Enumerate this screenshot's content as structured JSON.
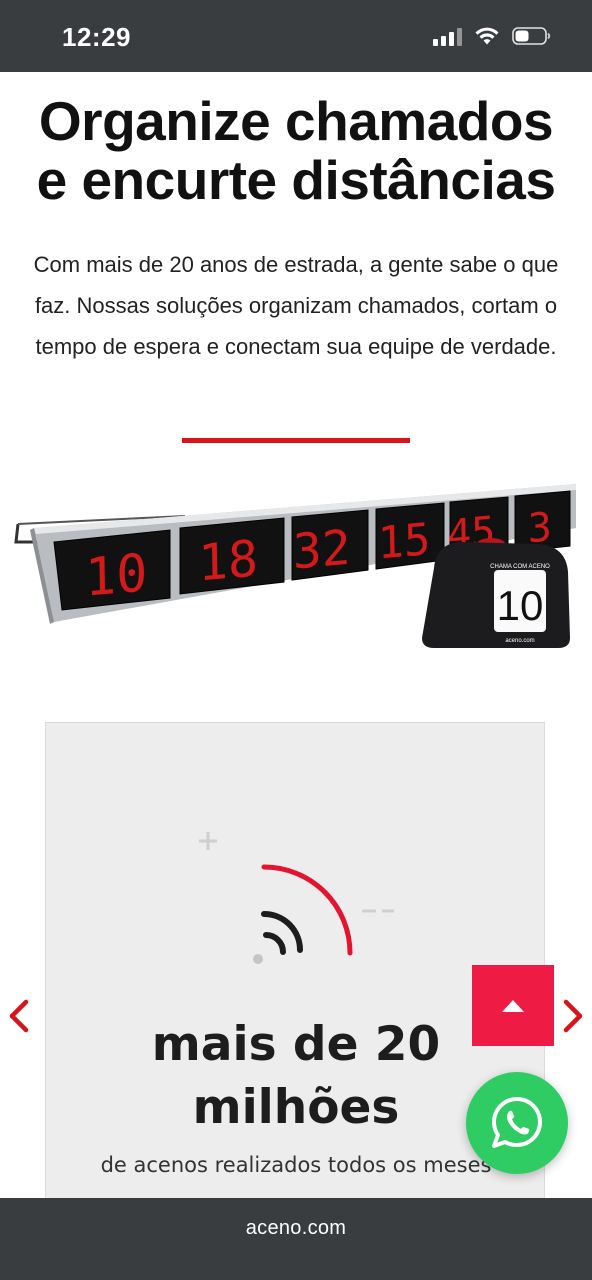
{
  "status_bar": {
    "time": "12:29",
    "icons": [
      "signal-icon",
      "wifi-icon",
      "battery-icon"
    ]
  },
  "hero": {
    "title_line1": "Organize chamados",
    "title_line2": "e encurte distâncias",
    "description": "Com mais de 20 anos de estrada, a gente sabe o que faz. Nossas soluções organizam chamados, cortam o tempo de espera e conectam sua equipe de verdade.",
    "accent_color": "#d9141b"
  },
  "product_image": {
    "display_numbers": [
      "10",
      "18",
      "32",
      "15",
      "45",
      "3"
    ],
    "device_label": "CHAMA COM ACENO",
    "device_number": "10",
    "device_brand": "aceno.com"
  },
  "stats_card": {
    "title_line1": "mais de 20",
    "title_line2": "milhões",
    "subtitle": "de acenos realizados todos os meses",
    "icon": "wave-signal-icon"
  },
  "controls": {
    "prev_icon": "chevron-left-icon",
    "next_icon": "chevron-right-icon",
    "back_to_top_icon": "caret-up-icon",
    "back_to_top_color": "#ee1b45",
    "whatsapp_icon": "whatsapp-icon",
    "whatsapp_color": "#2ecc62"
  },
  "browser": {
    "url": "aceno.com"
  }
}
